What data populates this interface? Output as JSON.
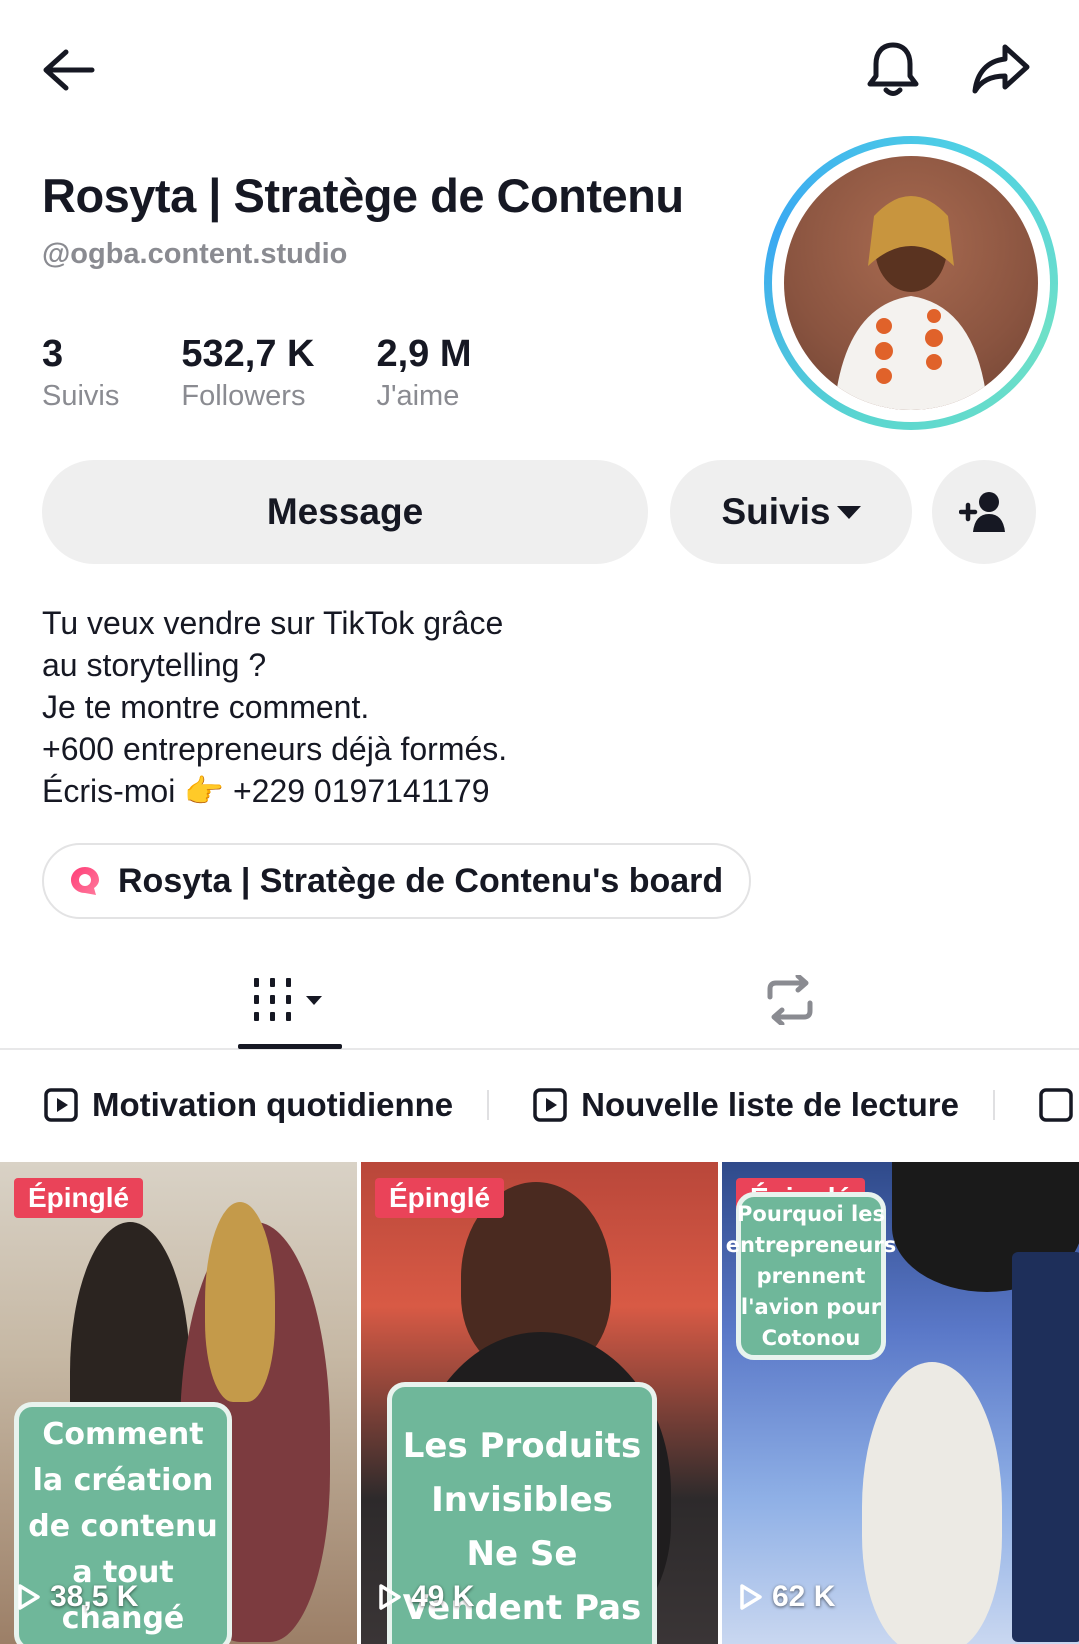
{
  "header": {
    "back_icon": "arrow-left-icon",
    "bell_icon": "bell-icon",
    "share_icon": "share-arrow-icon"
  },
  "profile": {
    "display_name": "Rosyta | Stratège de Contenu",
    "username": "@ogba.content.studio",
    "stats": [
      {
        "value": "3",
        "label": "Suivis"
      },
      {
        "value": "532,7 K",
        "label": "Followers"
      },
      {
        "value": "2,9 M",
        "label": "J'aime"
      }
    ]
  },
  "actions": {
    "message_label": "Message",
    "following_label": "Suivis",
    "add_friend_icon": "add-user-icon"
  },
  "bio": {
    "lines": [
      "Tu veux vendre sur TikTok grâce",
      "au storytelling ?",
      "Je te montre comment.",
      "+600 entrepreneurs déjà formés.",
      "Écris-moi 👉 +229 0197141179"
    ]
  },
  "board": {
    "label": "Rosyta | Stratège de Contenu's board"
  },
  "tabs": {
    "videos_icon": "grid-icon",
    "reposts_icon": "repost-icon"
  },
  "playlists": [
    {
      "label": "Motivation quotidienne"
    },
    {
      "label": "Nouvelle liste de lecture"
    }
  ],
  "videos": [
    {
      "pin_label": "Épinglé",
      "overlay_text": "Comment la création de contenu a tout changé",
      "views": "38,5 K"
    },
    {
      "pin_label": "Épinglé",
      "overlay_text": "Les Produits Invisibles Ne Se Vendent Pas",
      "views": "49 K"
    },
    {
      "pin_label": "Épinglé",
      "overlay_text": "Pourquoi les entrepreneurs prennent l'avion pour Cotonou",
      "views": "62 K"
    }
  ],
  "colors": {
    "pin_bg": "#ea4359",
    "overlay_green": "#6fb79a",
    "avatar_ring": "#3aa8f2"
  }
}
